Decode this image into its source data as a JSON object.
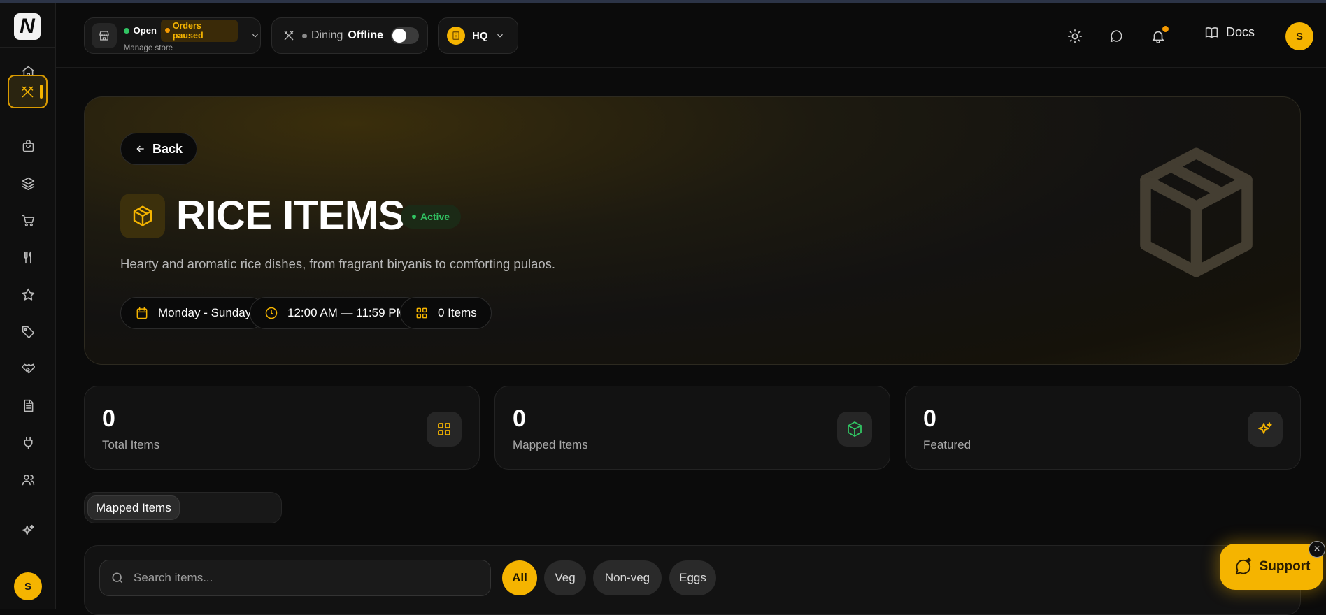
{
  "sidebar": {
    "logo": "N",
    "items": [
      {
        "name": "home-icon"
      },
      {
        "name": "dining-icon",
        "active": true
      },
      {
        "name": "bag-icon"
      },
      {
        "name": "layers-icon"
      },
      {
        "name": "cart-icon"
      },
      {
        "name": "utensils-icon"
      },
      {
        "name": "star-icon"
      },
      {
        "name": "tag-icon"
      },
      {
        "name": "handshake-icon"
      },
      {
        "name": "document-icon"
      },
      {
        "name": "plug-icon"
      },
      {
        "name": "users-icon"
      },
      {
        "name": "sparkles-icon"
      }
    ],
    "avatar": "S"
  },
  "topbar": {
    "store_status": "Open",
    "orders_status": "Orders paused",
    "manage_store": "Manage store",
    "dining_label": "Dining",
    "dining_status": "Offline",
    "location": "HQ",
    "docs": "Docs",
    "avatar": "S"
  },
  "hero": {
    "back": "Back",
    "title": "RICE ITEMS",
    "status": "Active",
    "description": "Hearty and aromatic rice dishes, from fragrant biryanis to comforting pulaos.",
    "chips": {
      "days": "Monday - Sunday",
      "hours": "12:00 AM — 11:59 PM",
      "items": "0 Items"
    }
  },
  "stats": [
    {
      "value": "0",
      "label": "Total Items"
    },
    {
      "value": "0",
      "label": "Mapped Items"
    },
    {
      "value": "0",
      "label": "Featured"
    }
  ],
  "tabs": {
    "active": "Mapped Items"
  },
  "items_panel": {
    "search_placeholder": "Search items...",
    "filters": [
      "All",
      "Veg",
      "Non-veg",
      "Eggs"
    ],
    "selected_filter": "All"
  },
  "support": {
    "label": "Support",
    "close": "×"
  },
  "colors": {
    "accent": "#f5b400",
    "active_green": "#31c463",
    "background": "#0b0b0b"
  }
}
